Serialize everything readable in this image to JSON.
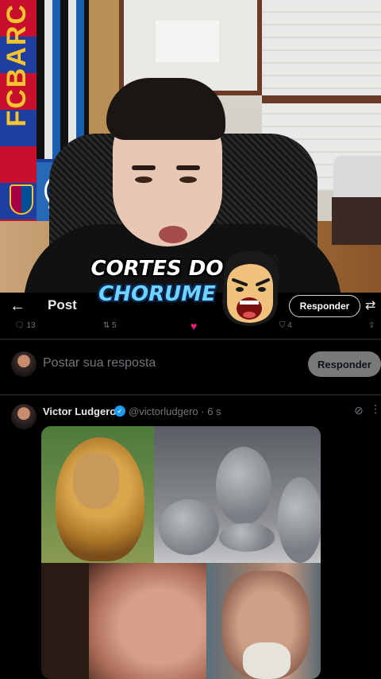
{
  "overlay": {
    "logo_line1": "CORTES DO",
    "logo_line2": "CHORUME"
  },
  "header": {
    "back_icon": "←",
    "title": "Post",
    "reply_button": "Responder",
    "filter_icon": "⇄"
  },
  "action_bar": {
    "replies": "13",
    "reposts": "5",
    "bookmarks": "4"
  },
  "compose": {
    "placeholder": "Postar sua resposta",
    "reply_button": "Responder"
  },
  "tweet": {
    "author_name": "Victor Ludgero",
    "handle": "@victorludgero",
    "time": "· 6 s"
  },
  "colors": {
    "background": "#000000",
    "like_pink": "#f91880",
    "verified_blue": "#1d9bf0",
    "logo_cyan": "#6fd3ff"
  }
}
